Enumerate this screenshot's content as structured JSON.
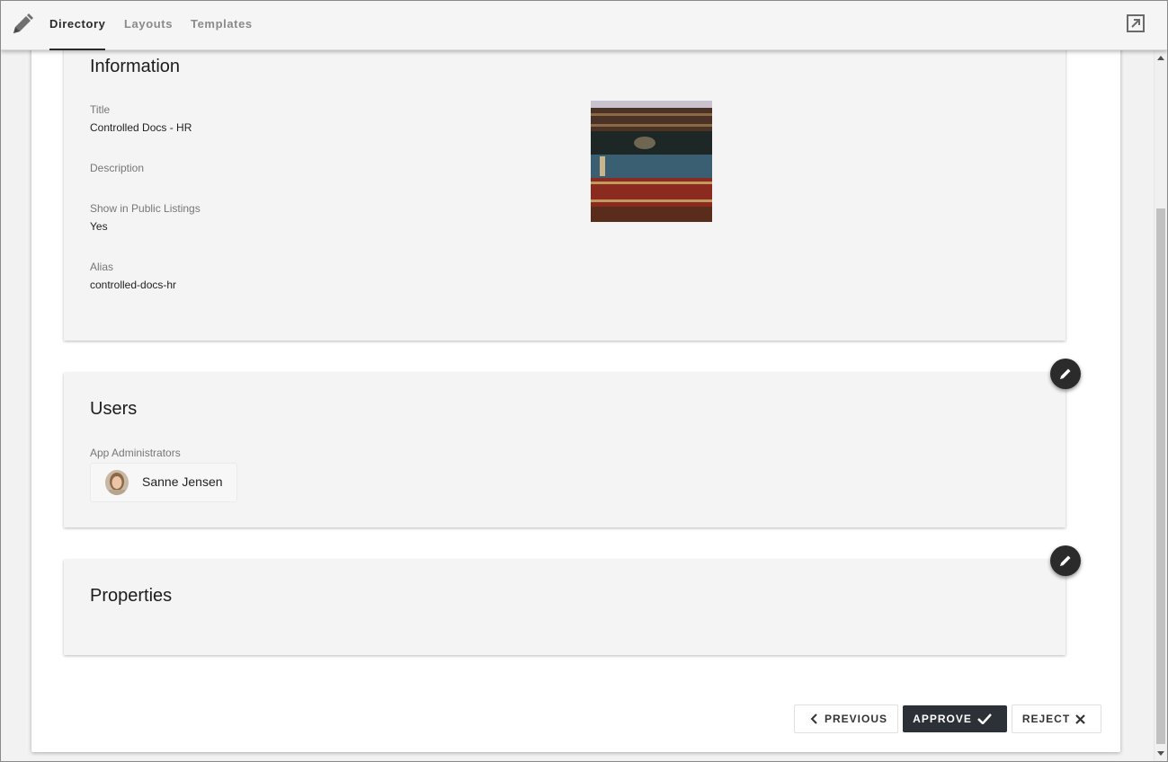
{
  "nav": {
    "tabs": [
      {
        "label": "Directory",
        "active": true
      },
      {
        "label": "Layouts",
        "active": false
      },
      {
        "label": "Templates",
        "active": false
      }
    ],
    "logo_icon": "pencil-icon",
    "external_icon": "open-external-icon"
  },
  "information": {
    "title": "Information",
    "fields": [
      {
        "label": "Title",
        "value": "Controlled Docs - HR"
      },
      {
        "label": "Description",
        "value": ""
      },
      {
        "label": "Show in Public Listings",
        "value": "Yes"
      },
      {
        "label": "Alias",
        "value": "controlled-docs-hr"
      }
    ],
    "image_icon": "books-stack-image"
  },
  "users": {
    "title": "Users",
    "admins_label": "App Administrators",
    "admins": [
      {
        "name": "Sanne Jensen"
      }
    ]
  },
  "properties": {
    "title": "Properties"
  },
  "actions": {
    "previous": "PREVIOUS",
    "approve": "APPROVE",
    "reject": "REJECT"
  },
  "colors": {
    "accent_dark": "#2b3137",
    "fab": "#2b2b2b",
    "card_bg": "#f4f4f4"
  }
}
